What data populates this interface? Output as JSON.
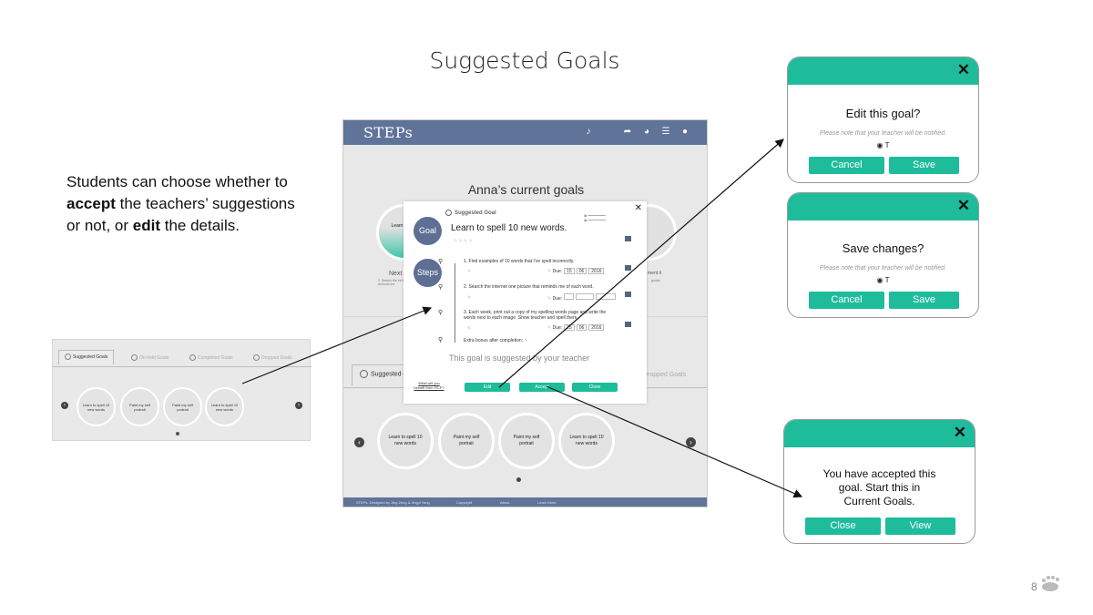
{
  "slide": {
    "title": "Suggested Goals",
    "description_parts": [
      "Students can choose whether to ",
      "accept",
      " the teachers’ suggestions or not, or ",
      "edit",
      " the details."
    ],
    "page_number": "8"
  },
  "thumbnail": {
    "tabs": [
      "Suggested Goals",
      "On-hold Goals",
      "Completed Goals",
      "Dropped Goals"
    ],
    "circles": [
      "Learn to spell 10 new words",
      "Paint my self portrait",
      "Paint my self portrait",
      "Learn to spell 10 new words"
    ]
  },
  "app": {
    "logo": "STEPs",
    "heading": "Anna’s current goals",
    "bg_circle_left": "Learn to\nnew",
    "bg_text_left": "Next",
    "bg_text_left_sub": "2. Search the int that reminds me",
    "bg_text_right": "ment it",
    "bg_text_right_sub": "goals",
    "tabs": [
      "Suggested Goals",
      "Dropped Goals"
    ],
    "circles": [
      "Learn to spell 10 new words",
      "Paint my self portrait",
      "Paint my self portrait",
      "Learn to spell 10 new words"
    ],
    "footer": [
      "STEPs. Designed by Jing Zeng & Jingyi Yang",
      "Copyright",
      "About",
      "Learn More"
    ]
  },
  "modal": {
    "label": "Suggested Goal",
    "goal_bubble": "Goal",
    "steps_bubble": "Steps",
    "goal_text": "Learn to spell 10 new words.",
    "steps": [
      "1.  Find examples of 10 words that I’ve spelt incorrectly.",
      "2.  Search the internet one picture that reminds me of each word.",
      "3.  Each week, print out a copy of my spelling words page and write the words next to each image. Show teacher and spell them."
    ],
    "due_label": "Due:",
    "due_1": [
      "15",
      "06",
      "2016"
    ],
    "due_2": [
      "",
      "",
      ""
    ],
    "due_3": [
      "25",
      "06",
      "2016"
    ],
    "extra_bonus": "Extra bonus after completion:",
    "suggested_by": "This goal is suggested by your teacher",
    "benefit_link": "What will you benefit from IYLP?",
    "buttons": {
      "edit": "Edit",
      "accept": "Accept",
      "close": "Close"
    }
  },
  "dialogs": {
    "edit": {
      "title": "Edit this goal?",
      "note": "Please note that your teacher will be notified.",
      "eye": "T",
      "cancel": "Cancel",
      "save": "Save"
    },
    "save": {
      "title": "Save changes?",
      "note": "Please note that your teacher will be notified.",
      "eye": "T",
      "cancel": "Cancel",
      "save": "Save"
    },
    "accepted": {
      "line1": "You have accepted this",
      "line2": "goal. Start this in",
      "line3": "Current Goals.",
      "close": "Close",
      "view": "View"
    }
  },
  "colors": {
    "accent": "#1ebc9b",
    "header": "#607399",
    "bubble": "#5f6e93"
  }
}
